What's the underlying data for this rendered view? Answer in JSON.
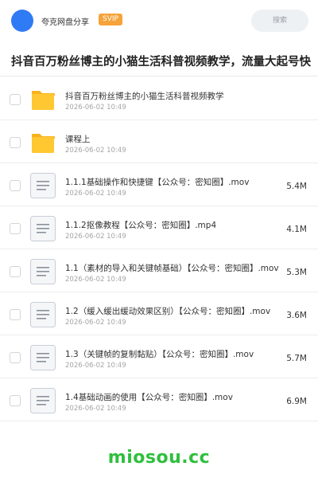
{
  "header": {
    "share_name": "夸克网盘分享",
    "badge": "SVIP",
    "search_label": "搜索",
    "avatar_color": "#2f7bf3"
  },
  "folder_title": "抖音百万粉丝博主的小猫生活科普视频教学，流量大起号快",
  "items": [
    {
      "type": "folder",
      "icon": "folder-icon",
      "name": "抖音百万粉丝博主的小猫生活科普视频教学",
      "date": "2026-06-02 10:49",
      "size": ""
    },
    {
      "type": "folder",
      "icon": "folder-icon",
      "name": "课程上",
      "date": "2026-06-02 10:49",
      "size": ""
    },
    {
      "type": "file",
      "icon": "file-icon",
      "name": "1.1.1基础操作和快捷键【公众号：密知圈】.mov",
      "date": "2026-06-02 10:49",
      "size": "5.4M"
    },
    {
      "type": "file",
      "icon": "file-icon",
      "name": "1.1.2抠像教程【公众号：密知圈】.mp4",
      "date": "2026-06-02 10:49",
      "size": "4.1M"
    },
    {
      "type": "file",
      "icon": "file-icon",
      "name": "1.1（素材的导入和关键帧基础）【公众号：密知圈】.mov",
      "date": "2026-06-02 10:49",
      "size": "5.3M"
    },
    {
      "type": "file",
      "icon": "file-icon",
      "name": "1.2（缓入缓出缓动效果区别）【公众号：密知圈】.mov",
      "date": "2026-06-02 10:49",
      "size": "3.6M"
    },
    {
      "type": "file",
      "icon": "file-icon",
      "name": "1.3（关键帧的复制黏贴）【公众号：密知圈】.mov",
      "date": "2026-06-02 10:49",
      "size": "5.7M"
    },
    {
      "type": "file",
      "icon": "file-icon",
      "name": "1.4基础动画的使用【公众号：密知圈】.mov",
      "date": "2026-06-02 10:49",
      "size": "6.9M"
    }
  ],
  "watermark": "miosou.cc",
  "colors": {
    "folder": "#ffc832",
    "folder_tab": "#f7b21c",
    "watermark": "#2fbf3d",
    "badge": "#f6a33a"
  }
}
